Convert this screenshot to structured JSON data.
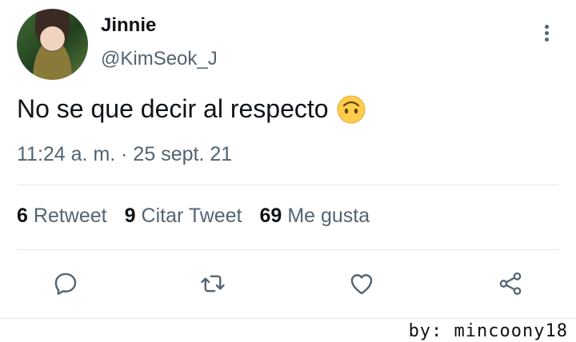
{
  "author": {
    "name": "Jinnie",
    "handle": "@KimSeok_J"
  },
  "tweet": {
    "text": "No se que decir al respecto",
    "emoji": "upside-down-face"
  },
  "timestamp": "11:24 a. m. · 25 sept. 21",
  "stats": [
    {
      "count": "6",
      "label": "Retweet"
    },
    {
      "count": "9",
      "label": "Citar Tweet"
    },
    {
      "count": "69",
      "label": "Me gusta"
    }
  ],
  "actions": [
    {
      "icon": "reply-icon"
    },
    {
      "icon": "retweet-icon"
    },
    {
      "icon": "heart-icon"
    },
    {
      "icon": "share-icon"
    }
  ],
  "watermark": "by: mincoony18",
  "colors": {
    "text": "#0f1419",
    "secondary": "#536471",
    "divider": "#e1e8ed"
  }
}
